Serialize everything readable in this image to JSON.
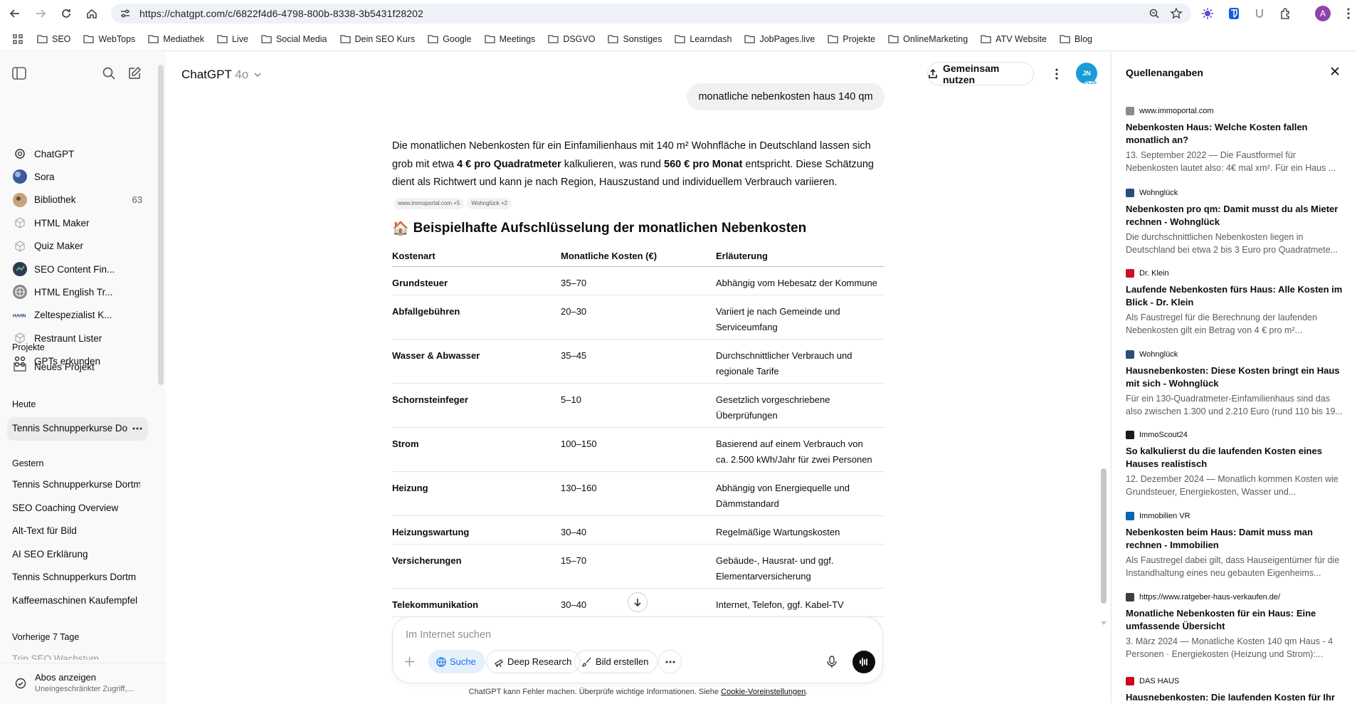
{
  "browser": {
    "url": "https://chatgpt.com/c/6822f4d6-4798-800b-8338-3b5431f28202",
    "profile_initial": "A",
    "bookmarks": [
      "SEO",
      "WebTops",
      "Mediathek",
      "Live",
      "Social Media",
      "Dein SEO Kurs",
      "Google",
      "Meetings",
      "DSGVO",
      "Sonstiges",
      "Learndash",
      "JobPages.live",
      "Projekte",
      "OnlineMarketing",
      "ATV Website",
      "Blog"
    ]
  },
  "sidebar": {
    "items": [
      {
        "label": "ChatGPT",
        "icon": "chatgpt-logo-icon"
      },
      {
        "label": "Sora",
        "icon": "sora-icon"
      },
      {
        "label": "Bibliothek",
        "icon": "library-icon",
        "count": "63"
      },
      {
        "label": "HTML Maker",
        "icon": "gpt-cube-icon"
      },
      {
        "label": "Quiz Maker",
        "icon": "gpt-cube-icon"
      },
      {
        "label": "SEO Content Fin...",
        "icon": "seo-gpt-icon"
      },
      {
        "label": "HTML English Tr...",
        "icon": "globe-gpt-icon"
      },
      {
        "label": "Zeltespezialist K...",
        "icon": "hahn-gpt-icon"
      },
      {
        "label": "Restraunt Lister",
        "icon": "gpt-cube-icon"
      },
      {
        "label": "GPTs erkunden",
        "icon": "grid-icon"
      }
    ],
    "projects_heading": "Projekte",
    "new_project": "Neues Projekt",
    "today_heading": "Heute",
    "today_chats": [
      "Tennis Schnupperkurse Dortm"
    ],
    "yesterday_heading": "Gestern",
    "yesterday_chats": [
      "Tennis Schnupperkurse Dortm",
      "SEO Coaching Overview",
      "Alt-Text für Bild",
      "AI SEO Erklärung",
      "Tennis Schnupperkurs Dortm",
      "Kaffeemaschinen Kaufempfel"
    ],
    "prev7_heading": "Vorherige 7 Tage",
    "prev7_partial": "Trip SEO Wachstum",
    "abos_title": "Abos anzeigen",
    "abos_sub": "Uneingeschränkter Zugriff,..."
  },
  "header": {
    "model_name": "ChatGPT",
    "model_version": "4o",
    "share_label": "Gemeinsam nutzen",
    "avatar_text": "JN",
    "avatar_badge": "PLUS"
  },
  "conversation": {
    "user_message": "monatliche nebenkosten haus 140 qm",
    "answer_p1_a": "Die monatlichen Nebenkosten für ein Einfamilienhaus mit 140 m² Wohnfläche in Deutschland lassen sich grob mit etwa ",
    "answer_p1_b1": "4 € pro Quadratmeter",
    "answer_p1_c": " kalkulieren, was rund ",
    "answer_p1_b2": "560 € pro Monat",
    "answer_p1_d": " entspricht. Diese Schätzung dient als Richtwert und kann je nach Region, Hauszustand und individuellem Verbrauch variieren.",
    "chips": [
      "www.immoportal.com +5",
      "Wohnglück +2"
    ],
    "heading_emoji": "🏠",
    "heading": "Beispielhafte Aufschlüsselung der monatlichen Nebenkosten",
    "table": {
      "headers": [
        "Kostenart",
        "Monatliche Kosten (€)",
        "Erläuterung"
      ],
      "rows": [
        [
          "Grundsteuer",
          "35–70",
          "Abhängig vom Hebesatz der Kommune"
        ],
        [
          "Abfallgebühren",
          "20–30",
          "Variiert je nach Gemeinde und Serviceumfang"
        ],
        [
          "Wasser & Abwasser",
          "35–45",
          "Durchschnittlicher Verbrauch und regionale Tarife"
        ],
        [
          "Schornsteinfeger",
          "5–10",
          "Gesetzlich vorgeschriebene Überprüfungen"
        ],
        [
          "Strom",
          "100–150",
          "Basierend auf einem Verbrauch von ca. 2.500 kWh/Jahr für zwei Personen"
        ],
        [
          "Heizung",
          "130–160",
          "Abhängig von Energiequelle und Dämmstandard"
        ],
        [
          "Heizungswartung",
          "30–40",
          "Regelmäßige Wartungskosten"
        ],
        [
          "Versicherungen",
          "15–70",
          "Gebäude-, Hausrat- und ggf. Elementarversicherung"
        ],
        [
          "Telekommunikation",
          "30–40",
          "Internet, Telefon, ggf. Kabel-TV"
        ]
      ]
    }
  },
  "composer": {
    "placeholder": "Im Internet suchen",
    "search_label": "Suche",
    "deep_research_label": "Deep Research",
    "image_label": "Bild erstellen"
  },
  "disclaimer": {
    "text": "ChatGPT kann Fehler machen. Überprüfe wichtige Informationen. Siehe ",
    "link": "Cookie-Voreinstellungen",
    "end": "."
  },
  "sources": {
    "title": "Quellenangaben",
    "items": [
      {
        "site": "www.immoportal.com",
        "favicon_color": "#8a8a8a",
        "title": "Nebenkosten Haus: Welche Kosten fallen monatlich an?",
        "snippet": "13. September 2022 — Die Faustformel für Nebenkosten lautet also: 4€ mal xm². Für ein Haus ..."
      },
      {
        "site": "Wohnglück",
        "favicon_color": "#2b4c7e",
        "title": "Nebenkosten pro qm: Damit musst du als Mieter rechnen - Wohnglück",
        "snippet": "Die durchschnittlichen Nebenkosten liegen in Deutschland bei etwa 2 bis 3 Euro pro Quadratmete..."
      },
      {
        "site": "Dr. Klein",
        "favicon_color": "#c8102e",
        "title": "Laufende Nebenkosten fürs Haus: Alle Kosten im Blick - Dr. Klein",
        "snippet": "Als Faustregel für die Berechnung der laufenden Nebenkosten gilt ein Betrag von 4 € pro m²..."
      },
      {
        "site": "Wohnglück",
        "favicon_color": "#2b4c7e",
        "title": "Hausnebenkosten: Diese Kosten bringt ein Haus mit sich - Wohnglück",
        "snippet": "Für ein 130-Quadratmeter-Einfamilienhaus sind das also zwischen 1.300 und 2.210 Euro (rund 110 bis 19..."
      },
      {
        "site": "ImmoScout24",
        "favicon_color": "#1b1b1b",
        "title": "So kalkulierst du die laufenden Kosten eines Hauses realistisch",
        "snippet": "12. Dezember 2024 — Monatlich kommen Kosten wie Grundsteuer, Energiekosten, Wasser und..."
      },
      {
        "site": "Immobilien VR",
        "favicon_color": "#0066b3",
        "title": "Nebenkosten beim Haus: Damit muss man rechnen - Immobilien",
        "snippet": "Als Faustregel dabei gilt, dass Hauseigentümer für die Instandhaltung eines neu gebauten Eigenheims..."
      },
      {
        "site": "https://www.ratgeber-haus-verkaufen.de/",
        "favicon_color": "#3d3d3d",
        "title": "Monatliche Nebenkosten für ein Haus: Eine umfassende Übersicht",
        "snippet": "3. März 2024 — Monatliche Kosten 140 qm Haus - 4 Personen · Energiekosten (Heizung und Strom):..."
      },
      {
        "site": "DAS HAUS",
        "favicon_color": "#d0021b",
        "title": "Hausnebenkosten: Die laufenden Kosten für Ihr",
        "snippet": ""
      }
    ]
  }
}
